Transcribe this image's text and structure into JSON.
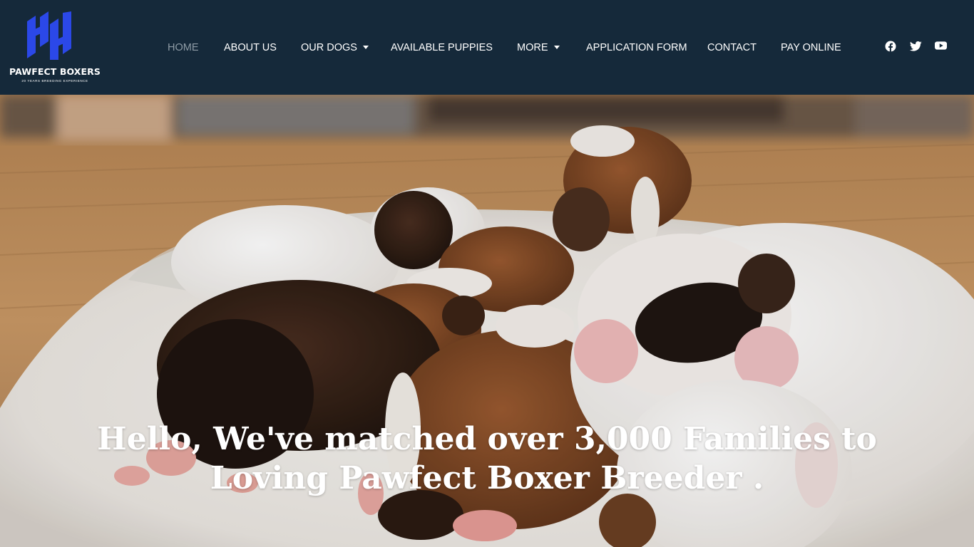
{
  "brand": {
    "name": "PAWFECT BOXERS",
    "tagline": "20 YEARS BREEDING EXPERIENCE",
    "logo_color": "#2b48e8"
  },
  "nav": {
    "items": [
      {
        "label": "HOME",
        "active": true
      },
      {
        "label": "ABOUT US"
      },
      {
        "label": "OUR DOGS",
        "dropdown": true
      },
      {
        "label": "AVAILABLE PUPPIES"
      },
      {
        "label": "MORE",
        "dropdown": true
      },
      {
        "label": "APPLICATION FORM"
      },
      {
        "label": "CONTACT"
      },
      {
        "label": "PAY ONLINE"
      }
    ]
  },
  "social": {
    "icons": [
      "facebook-icon",
      "twitter-icon",
      "youtube-icon"
    ]
  },
  "hero": {
    "heading": "Hello, We've matched over 3,000 Families to Loving Pawfect Boxer Breeder .",
    "image_subject": "litter of newborn boxer puppies sleeping on a white fluffy rug on a wooden floor"
  },
  "colors": {
    "header_bg": "#15293a",
    "nav_text": "#ffffff",
    "nav_active": "#8f9ca6",
    "hero_text": "#ffffff"
  }
}
